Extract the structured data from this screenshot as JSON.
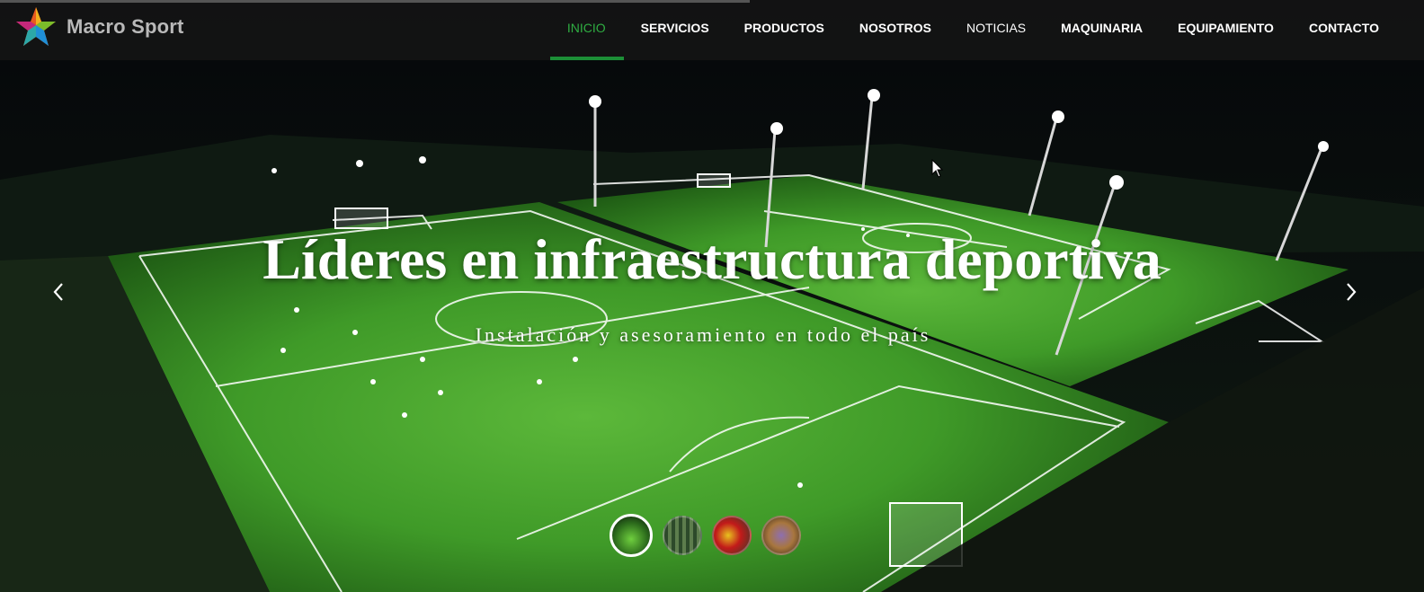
{
  "brand": {
    "name": "Macro Sport"
  },
  "nav": {
    "items": [
      {
        "label": "INICIO",
        "active": true
      },
      {
        "label": "SERVICIOS"
      },
      {
        "label": "PRODUCTOS"
      },
      {
        "label": "NOSOTROS"
      },
      {
        "label": "NOTICIAS"
      },
      {
        "label": "MAQUINARIA"
      },
      {
        "label": "EQUIPAMIENTO"
      },
      {
        "label": "CONTACTO"
      }
    ]
  },
  "slider": {
    "headline": "Líderes en infraestructura deportiva",
    "subline": "Instalación y asesoramiento en todo el país",
    "prev_icon": "chevron-left-icon",
    "next_icon": "chevron-right-icon",
    "slide_count": 4,
    "active_slide": 1
  },
  "colors": {
    "accent": "#2fae42",
    "accent_bar": "#1c8f37",
    "topbar": "#141414"
  }
}
